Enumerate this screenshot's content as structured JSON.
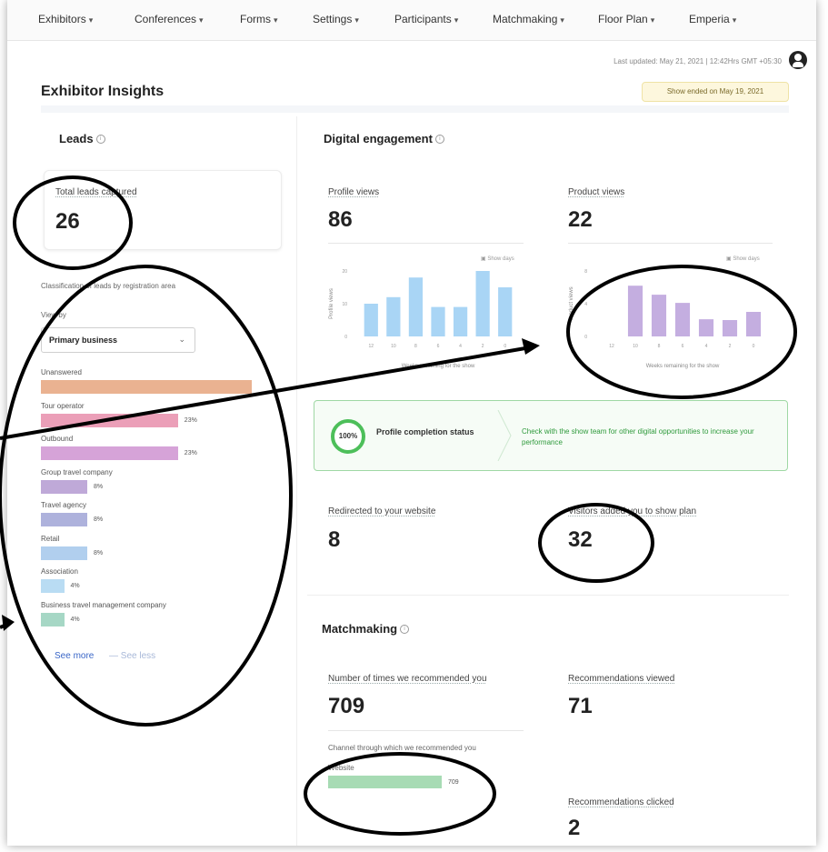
{
  "nav": {
    "items": [
      "Exhibitors",
      "Conferences",
      "Forms",
      "Settings",
      "Participants",
      "Matchmaking",
      "Floor Plan",
      "Emperia"
    ]
  },
  "header": {
    "last_updated": "Last updated: May 21, 2021 | 12:42Hrs GMT +05:30",
    "page_title": "Exhibitor Insights",
    "show_status": "Show ended on May 19, 2021"
  },
  "leads": {
    "title": "Leads",
    "total_label": "Total leads captured",
    "total_value": "26",
    "classification_label": "Classification of leads by registration area",
    "view_by_label": "View by",
    "view_by_value": "Primary business",
    "categories": [
      {
        "label": "Unanswered",
        "pct": "",
        "fraction": 1.0,
        "color": "#eab291"
      },
      {
        "label": "Tour operator",
        "pct": "23%",
        "fraction": 0.65,
        "color": "#eb9fb8"
      },
      {
        "label": "Outbound",
        "pct": "23%",
        "fraction": 0.65,
        "color": "#d6a3d8"
      },
      {
        "label": "Group travel company",
        "pct": "8%",
        "fraction": 0.22,
        "color": "#bfa9d8"
      },
      {
        "label": "Travel agency",
        "pct": "8%",
        "fraction": 0.22,
        "color": "#aeb2dc"
      },
      {
        "label": "Retail",
        "pct": "8%",
        "fraction": 0.22,
        "color": "#b1cfee"
      },
      {
        "label": "Association",
        "pct": "4%",
        "fraction": 0.11,
        "color": "#b9dcf3"
      },
      {
        "label": "Business travel management company",
        "pct": "4%",
        "fraction": 0.11,
        "color": "#a6d7c5"
      }
    ],
    "see_more": "See more",
    "see_less": "— See less"
  },
  "digital": {
    "title": "Digital engagement",
    "profile_views_label": "Profile views",
    "profile_views_value": "86",
    "product_views_label": "Product views",
    "product_views_value": "22",
    "show_days": "Show days",
    "x_axis_label": "Weeks remaining for the show",
    "profile_completion_pct": "100%",
    "profile_completion_label": "Profile completion status",
    "profile_message": "Check with the show team for other digital opportunities to increase your performance",
    "redirected_label": "Redirected to your website",
    "redirected_value": "8",
    "visitors_added_label": "Visitors added you to show plan",
    "visitors_added_value": "32"
  },
  "chart_data": [
    {
      "type": "bar",
      "ylabel": "Profile views",
      "xlabel": "Weeks remaining for the show",
      "categories": [
        "12",
        "10",
        "8",
        "6",
        "4",
        "2",
        "0"
      ],
      "values": [
        10,
        12,
        18,
        9,
        9,
        20,
        15
      ],
      "ylim": [
        0,
        20
      ],
      "yticks": [
        0,
        10,
        20
      ],
      "color": "#a9d5f5"
    },
    {
      "type": "bar",
      "ylabel": "Product views",
      "xlabel": "Weeks remaining for the show",
      "categories": [
        "12",
        "10",
        "8",
        "6",
        "4",
        "2",
        "0"
      ],
      "values": [
        0,
        6.2,
        5.1,
        4.1,
        2.1,
        2.0,
        3.0
      ],
      "ylim": [
        0,
        8
      ],
      "yticks": [
        0,
        4,
        8
      ],
      "color": "#c4aee0"
    },
    {
      "type": "bar",
      "title": "Channel through which we recommended you",
      "categories": [
        "Website"
      ],
      "values": [
        709
      ],
      "color": "#a7dbb4"
    }
  ],
  "matchmaking": {
    "title": "Matchmaking",
    "recommended_label": "Number of times we recommended you",
    "recommended_value": "709",
    "viewed_label": "Recommendations viewed",
    "viewed_value": "71",
    "channel_label": "Channel through which we recommended you",
    "channel_name": "Website",
    "channel_value": "709",
    "clicked_label": "Recommendations clicked",
    "clicked_value": "2"
  }
}
